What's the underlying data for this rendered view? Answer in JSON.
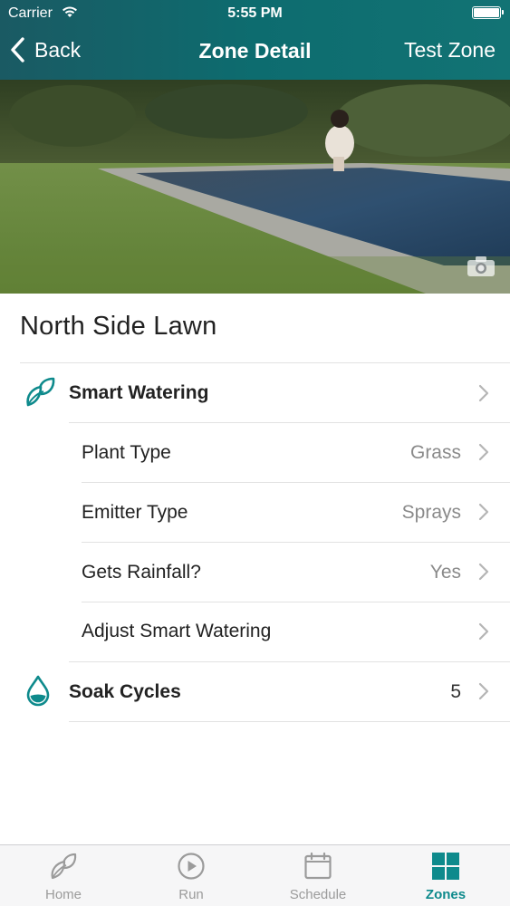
{
  "status_bar": {
    "carrier": "Carrier",
    "time": "5:55 PM"
  },
  "nav": {
    "back_label": "Back",
    "title": "Zone Detail",
    "right_label": "Test Zone"
  },
  "zone": {
    "name": "North Side Lawn"
  },
  "settings": {
    "smart_watering": {
      "label": "Smart Watering",
      "icon": "leaf-icon"
    },
    "plant_type": {
      "label": "Plant Type",
      "value": "Grass"
    },
    "emitter_type": {
      "label": "Emitter Type",
      "value": "Sprays"
    },
    "gets_rainfall": {
      "label": "Gets Rainfall?",
      "value": "Yes"
    },
    "adjust_smart_watering": {
      "label": "Adjust Smart Watering"
    },
    "soak_cycles": {
      "label": "Soak Cycles",
      "value": "5",
      "icon": "water-drop-icon"
    }
  },
  "tabbar": {
    "home": "Home",
    "run": "Run",
    "schedule": "Schedule",
    "zones": "Zones",
    "active": "zones"
  },
  "colors": {
    "accent": "#0e8a8c",
    "header": "#0d6c6f",
    "value_text": "#8a8a8a",
    "inactive_tab": "#9b9b9b"
  }
}
